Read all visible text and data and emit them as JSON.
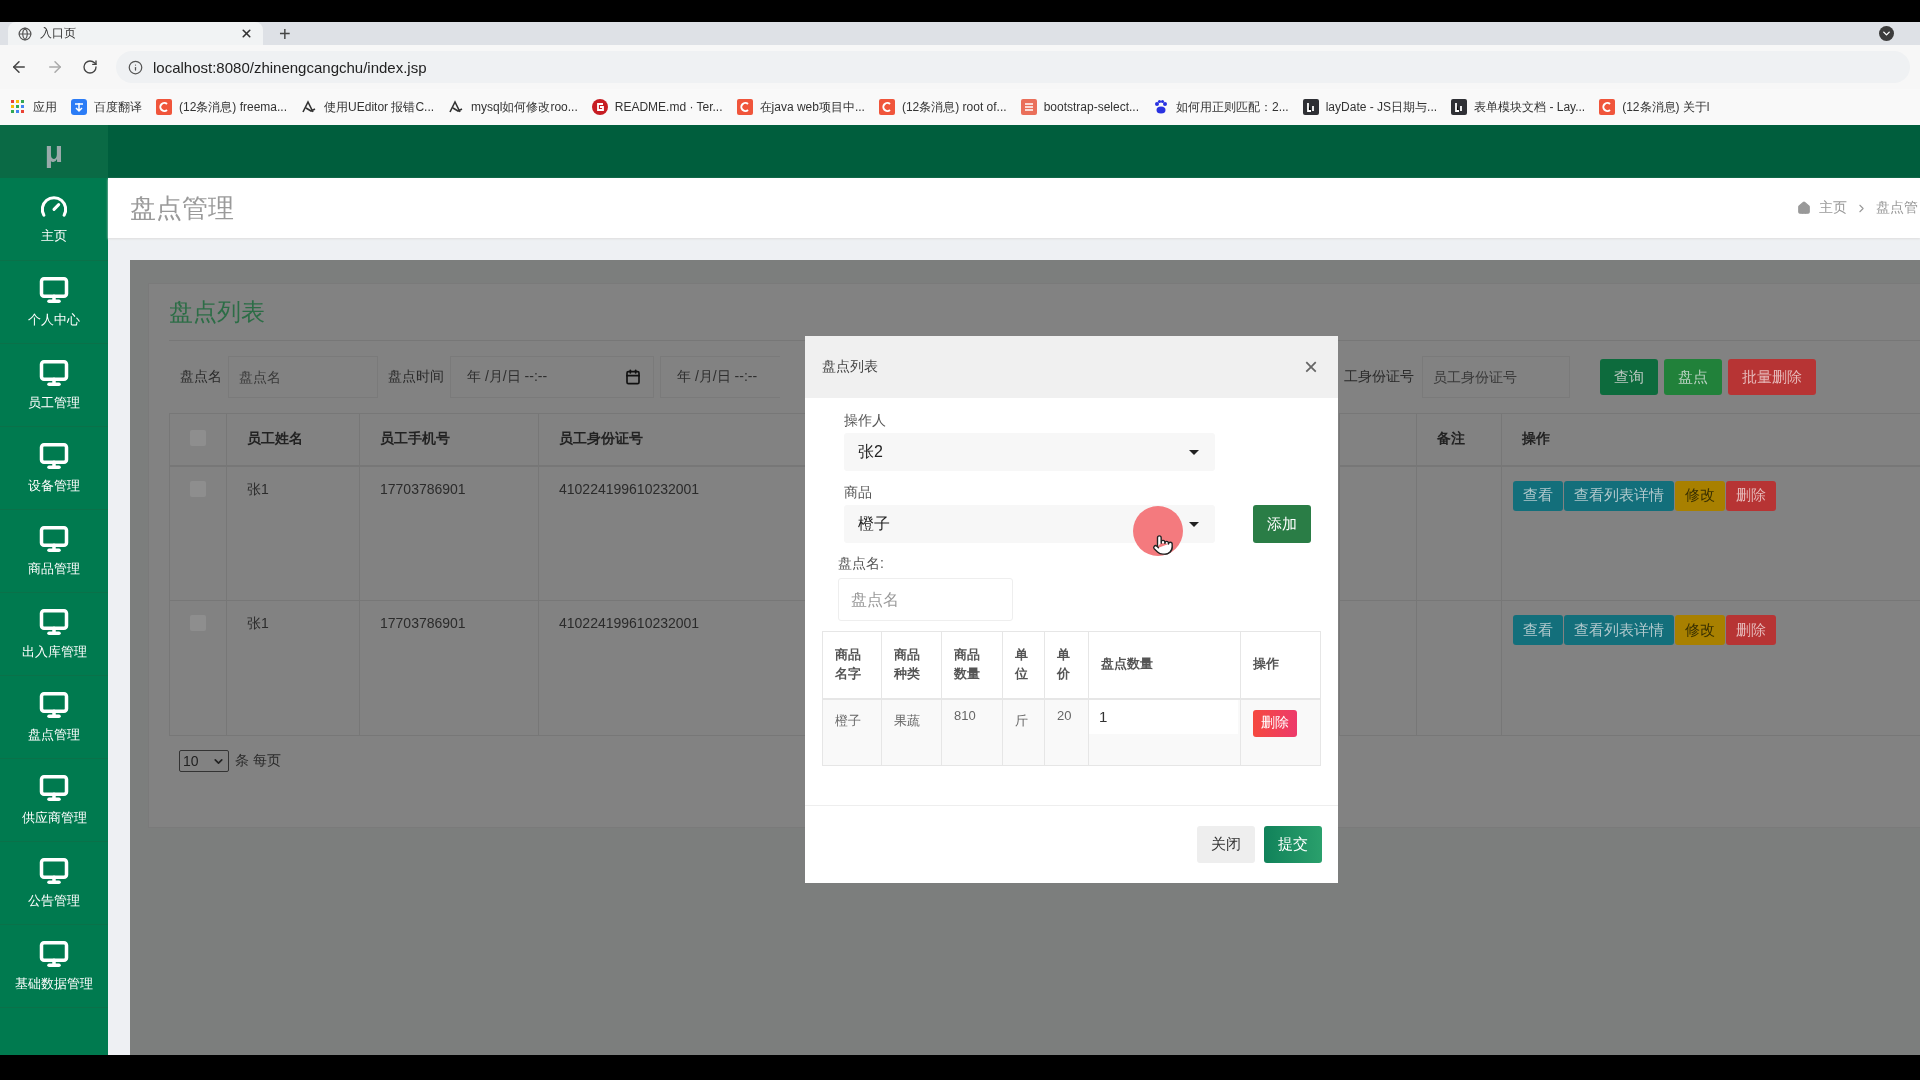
{
  "browser": {
    "tab": {
      "title": "入口页"
    },
    "new_tab": "+",
    "url": "localhost:8080/zhinengcangchu/index.jsp",
    "bookmarks": [
      {
        "kind": "apps",
        "label": "应用"
      },
      {
        "kind": "translate",
        "label": "百度翻译"
      },
      {
        "kind": "csdn",
        "label": "(12条消息) freema..."
      },
      {
        "kind": "ghost",
        "label": "使用UEditor 报错C..."
      },
      {
        "kind": "ghost",
        "label": "mysql如何修改roo..."
      },
      {
        "kind": "gitee",
        "label": "README.md · Ter..."
      },
      {
        "kind": "csdn",
        "label": "在java web项目中..."
      },
      {
        "kind": "csdn",
        "label": "(12条消息) root of..."
      },
      {
        "kind": "jianshu",
        "label": "bootstrap-select..."
      },
      {
        "kind": "baidu",
        "label": "如何用正则匹配：2..."
      },
      {
        "kind": "layui",
        "label": "layDate - JS日期与..."
      },
      {
        "kind": "layui",
        "label": "表单模块文档 - Lay..."
      },
      {
        "kind": "csdn",
        "label": "(12条消息) 关于l"
      }
    ]
  },
  "logo": "μ",
  "sidebar": [
    {
      "kind": "dashboard",
      "label": "主页"
    },
    {
      "kind": "monitor",
      "label": "个人中心"
    },
    {
      "kind": "monitor",
      "label": "员工管理"
    },
    {
      "kind": "monitor",
      "label": "设备管理"
    },
    {
      "kind": "monitor",
      "label": "商品管理"
    },
    {
      "kind": "monitor",
      "label": "出入库管理"
    },
    {
      "kind": "monitor",
      "label": "盘点管理"
    },
    {
      "kind": "monitor",
      "label": "供应商管理"
    },
    {
      "kind": "monitor",
      "label": "公告管理"
    },
    {
      "kind": "monitor",
      "label": "基础数据管理"
    }
  ],
  "page_title": "盘点管理",
  "breadcrumb": [
    "主页",
    "盘点管"
  ],
  "card_title": "盘点列表",
  "filters": {
    "name": {
      "label": "盘点名",
      "placeholder": "盘点名"
    },
    "time": {
      "label": "盘点时间",
      "from": "年 /月/日 --:--",
      "to": "年 /月/日 --:--"
    },
    "id_card": {
      "label": "工身份证号",
      "placeholder": "员工身份证号"
    }
  },
  "buttons": [
    {
      "kind": "search",
      "label": "查询"
    },
    {
      "kind": "primary",
      "label": "盘点"
    },
    {
      "kind": "danger",
      "label": "批量删除"
    }
  ],
  "table": {
    "header_checked": false,
    "columns_left": [
      "员工姓名",
      "员工手机号",
      "员工身份证号"
    ],
    "columns_right": [
      "备注",
      "操作"
    ],
    "rows": [
      {
        "checked": false,
        "cells": [
          "张1",
          "17703786901",
          "410224199610232001"
        ],
        "actions": [
          {
            "kind": "info",
            "label": "查看"
          },
          {
            "kind": "info",
            "label": "查看列表详情"
          },
          {
            "kind": "warning",
            "label": "修改"
          },
          {
            "kind": "danger",
            "label": "删除"
          }
        ]
      },
      {
        "checked": false,
        "cells": [
          "张1",
          "17703786901",
          "410224199610232001"
        ],
        "actions": [
          {
            "kind": "info",
            "label": "查看"
          },
          {
            "kind": "info",
            "label": "查看列表详情"
          },
          {
            "kind": "warning",
            "label": "修改"
          },
          {
            "kind": "danger",
            "label": "删除"
          }
        ]
      }
    ]
  },
  "page_size": "10",
  "page_size_label": "条 每页",
  "modal": {
    "title": "盘点列表",
    "close": "×",
    "operator": {
      "label": "操作人",
      "value": "张2"
    },
    "product": {
      "label": "商品",
      "value": "橙子"
    },
    "add_button": "添加",
    "name": {
      "label": "盘点名:",
      "placeholder": "盘点名"
    },
    "columns": [
      "商品名字",
      "商品种类",
      "商品数量",
      "单位",
      "单价",
      "盘点数量",
      "操作"
    ],
    "rows": [
      {
        "cells": [
          "橙子",
          "果蔬",
          "810",
          "斤",
          "20"
        ],
        "count": "1",
        "action": "删除"
      }
    ],
    "footer": [
      {
        "kind": "default",
        "label": "关闭"
      },
      {
        "kind": "primary",
        "label": "提交"
      }
    ]
  }
}
